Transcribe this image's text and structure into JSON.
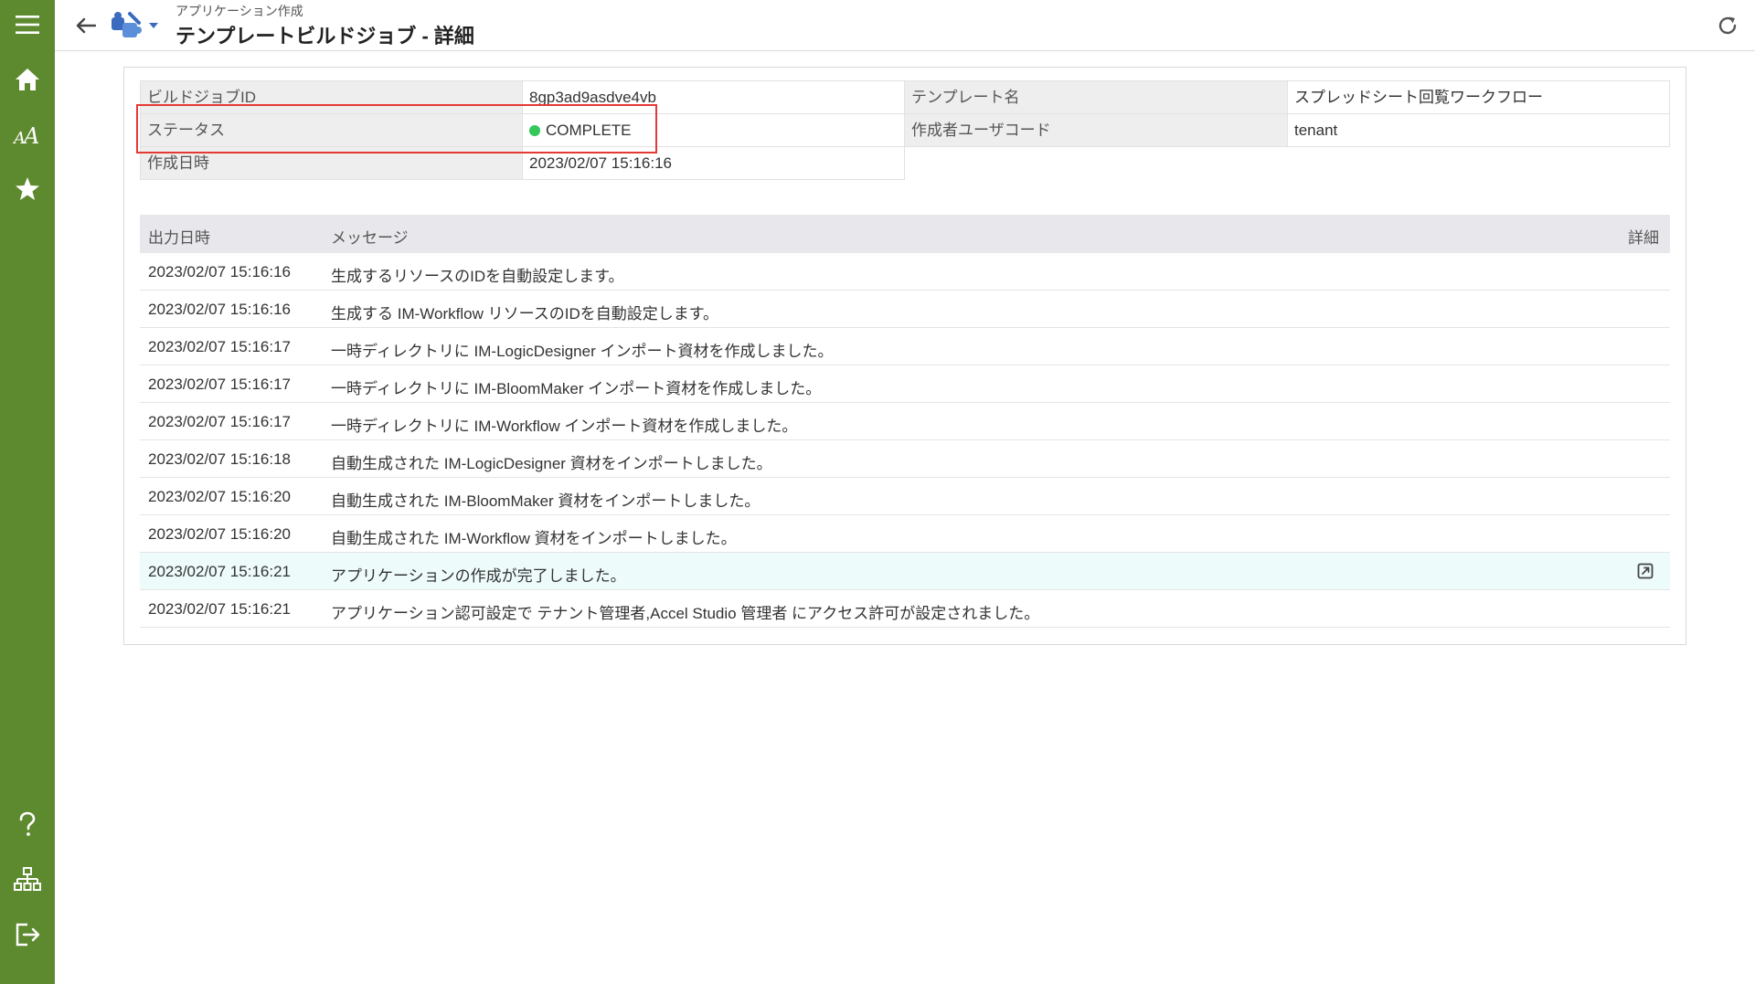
{
  "sidebar": {
    "menu_icon": "hamburger-icon",
    "items": [
      {
        "icon": "home-icon"
      },
      {
        "icon": "font-size-icon"
      },
      {
        "icon": "star-icon"
      }
    ],
    "bottom_items": [
      {
        "icon": "help-icon"
      },
      {
        "icon": "sitemap-icon"
      },
      {
        "icon": "logout-icon"
      }
    ]
  },
  "header": {
    "subtitle": "アプリケーション作成",
    "title": "テンプレートビルドジョブ - 詳細"
  },
  "info": {
    "build_job_id_label": "ビルドジョブID",
    "build_job_id_value": "8gp3ad9asdve4vb",
    "template_name_label": "テンプレート名",
    "template_name_value": "スプレッドシート回覧ワークフロー",
    "status_label": "ステータス",
    "status_value": "COMPLETE",
    "status_color": "#34c759",
    "creator_label": "作成者ユーザコード",
    "creator_value": "tenant",
    "created_at_label": "作成日時",
    "created_at_value": "2023/02/07 15:16:16"
  },
  "log": {
    "headers": {
      "time": "出力日時",
      "message": "メッセージ",
      "detail": "詳細"
    },
    "rows": [
      {
        "time": "2023/02/07 15:16:16",
        "message": "生成するリソースのIDを自動設定します。"
      },
      {
        "time": "2023/02/07 15:16:16",
        "message": "生成する IM-Workflow リソースのIDを自動設定します。"
      },
      {
        "time": "2023/02/07 15:16:17",
        "message": "一時ディレクトリに IM-LogicDesigner インポート資材を作成しました。"
      },
      {
        "time": "2023/02/07 15:16:17",
        "message": "一時ディレクトリに IM-BloomMaker インポート資材を作成しました。"
      },
      {
        "time": "2023/02/07 15:16:17",
        "message": "一時ディレクトリに IM-Workflow インポート資材を作成しました。"
      },
      {
        "time": "2023/02/07 15:16:18",
        "message": "自動生成された IM-LogicDesigner 資材をインポートしました。"
      },
      {
        "time": "2023/02/07 15:16:20",
        "message": "自動生成された IM-BloomMaker 資材をインポートしました。"
      },
      {
        "time": "2023/02/07 15:16:20",
        "message": "自動生成された IM-Workflow 資材をインポートしました。"
      },
      {
        "time": "2023/02/07 15:16:21",
        "message": "アプリケーションの作成が完了しました。"
      },
      {
        "time": "2023/02/07 15:16:21",
        "message": "アプリケーション認可設定で テナント管理者,Accel Studio 管理者 にアクセス許可が設定されました。"
      }
    ]
  }
}
